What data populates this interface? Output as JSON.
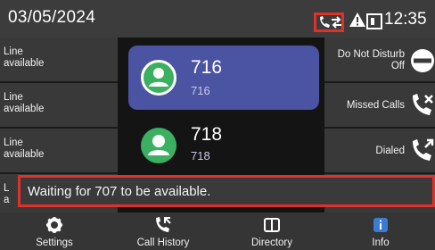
{
  "status_bar": {
    "date": "03/05/2024",
    "time": "12:35",
    "icons": [
      "call-forward-icon",
      "warning-icon",
      "screen-icon"
    ]
  },
  "lines": [
    {
      "line1": "Line",
      "line2": "available"
    },
    {
      "line1": "Line",
      "line2": "available"
    },
    {
      "line1": "Line",
      "line2": "available"
    },
    {
      "line1": "L",
      "line2": "a"
    }
  ],
  "contacts": [
    {
      "number": "716",
      "sub": "716",
      "selected": true
    },
    {
      "number": "718",
      "sub": "718",
      "selected": false
    }
  ],
  "right_keys": [
    {
      "label_line1": "Do Not Disturb",
      "label_line2": "Off",
      "icon": "dnd-icon"
    },
    {
      "label_line1": "Missed Calls",
      "label_line2": "",
      "icon": "missed-calls-icon"
    },
    {
      "label_line1": "Dialed",
      "label_line2": "",
      "icon": "dialed-icon"
    }
  ],
  "toast": {
    "message": "Waiting for 707 to be available."
  },
  "bottom_nav": [
    {
      "label": "Settings",
      "icon": "gear-icon"
    },
    {
      "label": "Call History",
      "icon": "call-history-icon"
    },
    {
      "label": "Directory",
      "icon": "book-icon"
    },
    {
      "label": "Info",
      "icon": "info-icon"
    }
  ],
  "colors": {
    "accent": "#4a54a3",
    "avatar": "#3bb061",
    "highlight": "#e0302a",
    "info": "#3a7bd5"
  }
}
